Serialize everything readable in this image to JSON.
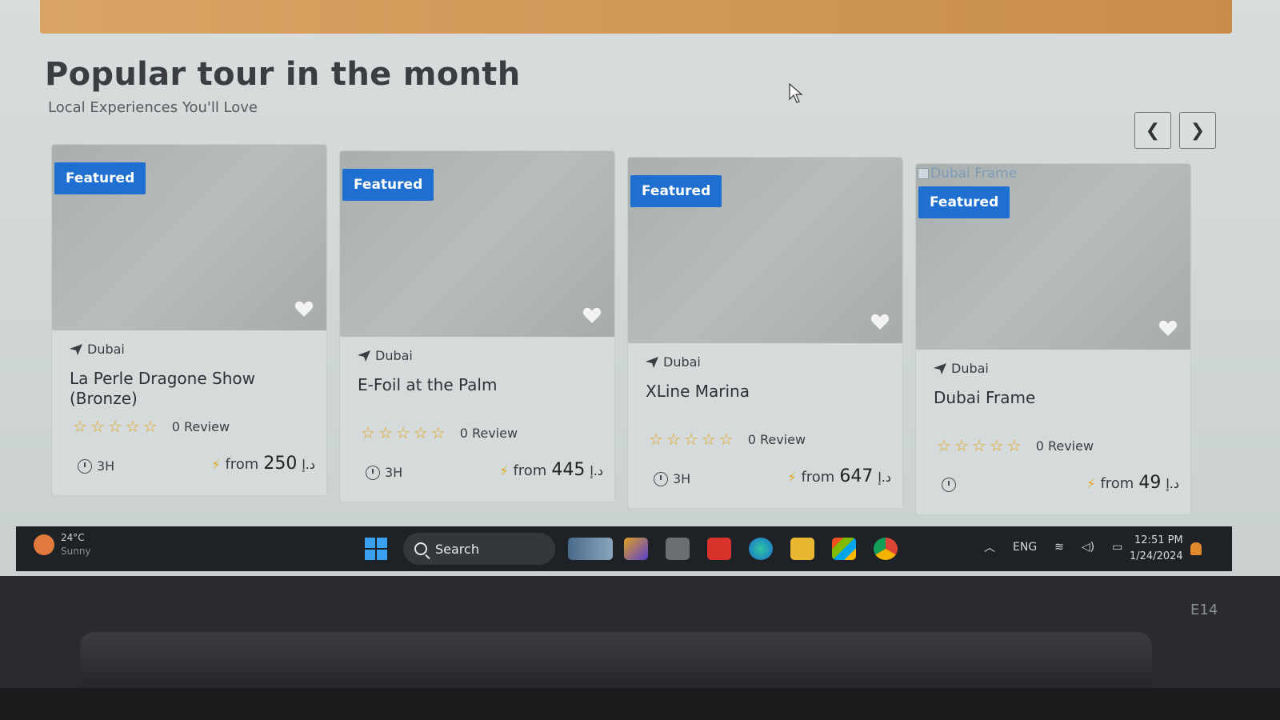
{
  "section": {
    "title": "Popular tour in the month",
    "subtitle": "Local Experiences You'll Love"
  },
  "nav": {
    "prev": "❮",
    "next": "❯"
  },
  "cards": [
    {
      "badge": "Featured",
      "location": "Dubai",
      "name": "La Perle Dragone Show (Bronze)",
      "reviews": "0 Review",
      "duration": "3H",
      "from_label": "from",
      "price": "250",
      "currency": "د.إ",
      "broken_image_alt": ""
    },
    {
      "badge": "Featured",
      "location": "Dubai",
      "name": "E-Foil at the Palm",
      "reviews": "0 Review",
      "duration": "3H",
      "from_label": "from",
      "price": "445",
      "currency": "د.إ",
      "broken_image_alt": ""
    },
    {
      "badge": "Featured",
      "location": "Dubai",
      "name": "XLine Marina",
      "reviews": "0 Review",
      "duration": "3H",
      "from_label": "from",
      "price": "647",
      "currency": "د.إ",
      "broken_image_alt": ""
    },
    {
      "badge": "Featured",
      "location": "Dubai",
      "name": "Dubai Frame",
      "reviews": "0 Review",
      "duration": "",
      "from_label": "from",
      "price": "49",
      "currency": "د.إ",
      "broken_image_alt": "Dubai Frame"
    }
  ],
  "rating": {
    "stars": 5,
    "filled": 0
  },
  "taskbar": {
    "weather_temp": "24°C",
    "weather_cond": "Sunny",
    "search_label": "Search",
    "language": "ENG",
    "time": "12:51 PM",
    "date": "1/24/2024"
  },
  "device": {
    "model_label": "E14"
  },
  "colors": {
    "badge": "#1e6fd0",
    "star": "#e3a21a",
    "banner": "#d9a464"
  }
}
